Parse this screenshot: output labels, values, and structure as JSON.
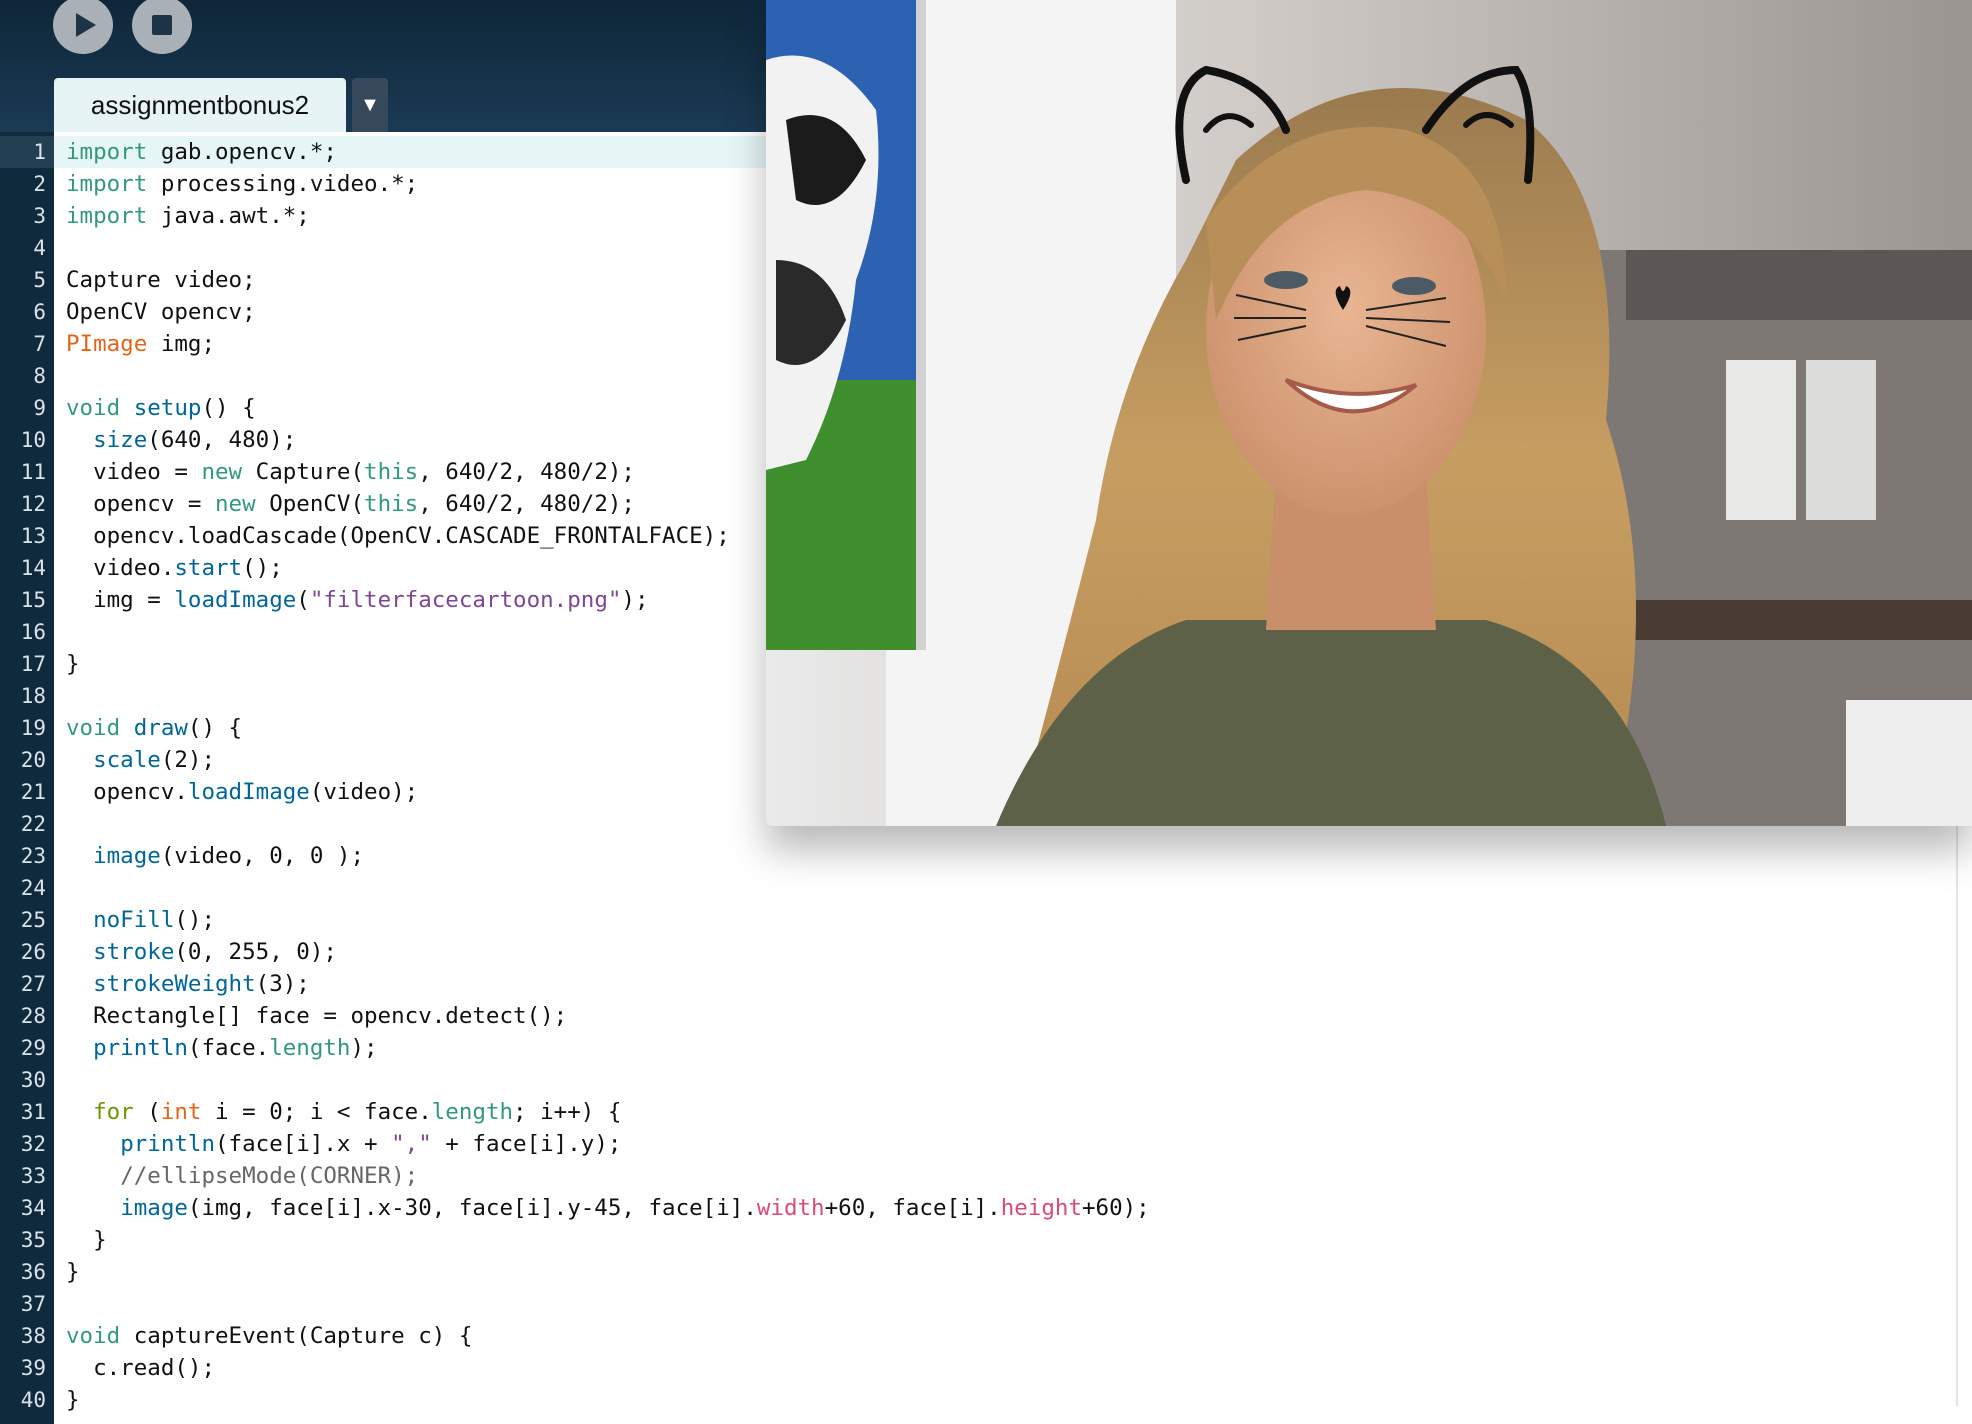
{
  "toolbar": {
    "run_icon": "play-icon",
    "stop_icon": "stop-icon"
  },
  "tab": {
    "label": "assignmentbonus2",
    "menu_glyph": "▼"
  },
  "editor": {
    "active_line": 1,
    "lines": [
      {
        "n": "1",
        "html": "<span class=\"kw\">import</span> gab.opencv.*;"
      },
      {
        "n": "2",
        "html": "<span class=\"kw\">import</span> processing.video.*;"
      },
      {
        "n": "3",
        "html": "<span class=\"kw\">import</span> java.awt.*;"
      },
      {
        "n": "4",
        "html": ""
      },
      {
        "n": "5",
        "html": "Capture video;"
      },
      {
        "n": "6",
        "html": "OpenCV opencv;"
      },
      {
        "n": "7",
        "html": "<span class=\"ty\">PImage</span> img;"
      },
      {
        "n": "8",
        "html": ""
      },
      {
        "n": "9",
        "html": "<span class=\"kw\">void</span> <span class=\"fn\">setup</span>() {"
      },
      {
        "n": "10",
        "html": "  <span class=\"fn\">size</span>(640, 480);"
      },
      {
        "n": "11",
        "html": "  video = <span class=\"kw\">new</span> Capture(<span class=\"kw\">this</span>, 640/2, 480/2);"
      },
      {
        "n": "12",
        "html": "  opencv = <span class=\"kw\">new</span> OpenCV(<span class=\"kw\">this</span>, 640/2, 480/2);"
      },
      {
        "n": "13",
        "html": "  opencv.loadCascade(OpenCV.CASCADE_FRONTALFACE);"
      },
      {
        "n": "14",
        "html": "  video.<span class=\"fn\">start</span>();"
      },
      {
        "n": "15",
        "html": "  img = <span class=\"fn\">loadImage</span>(<span class=\"str\">\"filterfacecartoon.png\"</span>);"
      },
      {
        "n": "16",
        "html": ""
      },
      {
        "n": "17",
        "html": "}"
      },
      {
        "n": "18",
        "html": ""
      },
      {
        "n": "19",
        "html": "<span class=\"kw\">void</span> <span class=\"fn\">draw</span>() {"
      },
      {
        "n": "20",
        "html": "  <span class=\"fn\">scale</span>(2);"
      },
      {
        "n": "21",
        "html": "  opencv.<span class=\"fn\">loadImage</span>(video);"
      },
      {
        "n": "22",
        "html": ""
      },
      {
        "n": "23",
        "html": "  <span class=\"fn\">image</span>(video, 0, 0 );"
      },
      {
        "n": "24",
        "html": ""
      },
      {
        "n": "25",
        "html": "  <span class=\"fn\">noFill</span>();"
      },
      {
        "n": "26",
        "html": "  <span class=\"fn\">stroke</span>(0, 255, 0);"
      },
      {
        "n": "27",
        "html": "  <span class=\"fn\">strokeWeight</span>(3);"
      },
      {
        "n": "28",
        "html": "  Rectangle[] face = opencv.detect();"
      },
      {
        "n": "29",
        "html": "  <span class=\"fn\">println</span>(face.<span class=\"kw\">length</span>);"
      },
      {
        "n": "30",
        "html": ""
      },
      {
        "n": "31",
        "html": "  <span class=\"ctl\">for</span> (<span class=\"ty\">int</span> i = 0; i &lt; face.<span class=\"kw\">length</span>; i++) {"
      },
      {
        "n": "32",
        "html": "    <span class=\"fn\">println</span>(face[i].x + <span class=\"str\">\",\"</span> + face[i].y);"
      },
      {
        "n": "33",
        "html": "    <span class=\"cm\">//ellipseMode(CORNER);</span>"
      },
      {
        "n": "34",
        "html": "    <span class=\"fn\">image</span>(img, face[i].x-30, face[i].y-45, face[i].<span class=\"fld\">width</span>+60, face[i].<span class=\"fld\">height</span>+60);"
      },
      {
        "n": "35",
        "html": "  }"
      },
      {
        "n": "36",
        "html": "}"
      },
      {
        "n": "37",
        "html": ""
      },
      {
        "n": "38",
        "html": "<span class=\"kw\">void</span> captureEvent(Capture c) {"
      },
      {
        "n": "39",
        "html": "  c.read();"
      },
      {
        "n": "40",
        "html": "}"
      }
    ]
  },
  "sketch_window": {
    "content": "webcam-feed-with-cat-filter"
  }
}
